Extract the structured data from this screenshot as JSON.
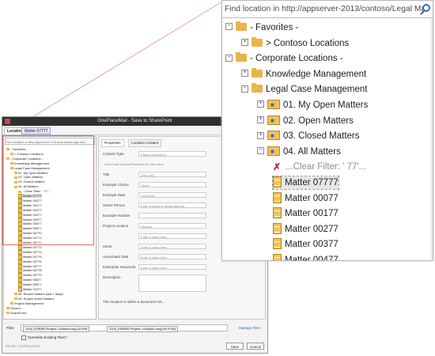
{
  "dialog": {
    "title": "OnePlaceMail - Save to SharePoint",
    "tabs": [
      "Location",
      "Matter 07777"
    ],
    "search_text": "Find location in http://appserver-2013/contoso/Legal Mat",
    "tree": [
      {
        "label": "- Favorites -",
        "level": 0
      },
      {
        "label": "> Contoso Locations",
        "level": 1
      },
      {
        "label": "- Corporate Locations -",
        "level": 0
      },
      {
        "label": "Knowledge Management",
        "level": 1
      },
      {
        "label": "Legal Case Management",
        "level": 1
      },
      {
        "label": "01. My Open Matters",
        "level": 2
      },
      {
        "label": "02. Open Matters",
        "level": 2
      },
      {
        "label": "03. Closed Matters",
        "level": 2
      },
      {
        "label": "04. All Matters",
        "level": 2
      },
      {
        "label": "...Clear Filter: ' 77'...",
        "level": 3
      },
      {
        "label": "Matter 07777",
        "level": 3
      },
      {
        "label": "Matter 00077",
        "level": 3
      },
      {
        "label": "Matter 00177",
        "level": 3
      },
      {
        "label": "Matter 00277",
        "level": 3
      },
      {
        "label": "Matter 00377",
        "level": 3
      },
      {
        "label": "Matter 00477",
        "level": 3
      },
      {
        "label": "Matter 00577",
        "level": 3
      },
      {
        "label": "Matter 00677",
        "level": 3
      },
      {
        "label": "Matter 00770",
        "level": 3
      },
      {
        "label": "Matter 00771",
        "level": 3
      },
      {
        "label": "Matter 00772",
        "level": 3
      },
      {
        "label": "Matter 00773",
        "level": 3
      },
      {
        "label": "Matter 00774",
        "level": 3
      },
      {
        "label": "Matter 00775",
        "level": 3
      },
      {
        "label": "Matter 00776",
        "level": 3
      },
      {
        "label": "Matter 00777",
        "level": 3
      },
      {
        "label": "Matter 00778",
        "level": 3
      },
      {
        "label": "Matter 00779",
        "level": 3
      },
      {
        "label": "Matter 00877",
        "level": 3
      },
      {
        "label": "Matter 00977",
        "level": 3
      },
      {
        "label": "Matter 01077",
        "level": 3
      },
      {
        "label": "05. Recent Matters (last 7 days)",
        "level": 2
      },
      {
        "label": "06. Search Active Matters",
        "level": 2
      },
      {
        "label": "Project Management",
        "level": 1
      },
      {
        "label": "Recent -",
        "level": 0
      },
      {
        "label": "SharePoint -",
        "level": 0
      }
    ],
    "props_tabs": [
      "Properties",
      "Location Content"
    ],
    "fields": [
      {
        "label": "Content Type",
        "value": "Project Document"
      },
      {
        "label": "",
        "value": "Use Email Subject/Filename as Title value"
      },
      {
        "label": "Title",
        "value": "[Sub Del]"
      },
      {
        "label": "Example Choice",
        "value": "Green"
      },
      {
        "label": "Example Date",
        "value": "1/06/2016"
      },
      {
        "label": "Select Person",
        "value": "Enter a name or email address..."
      },
      {
        "label": "Example Number",
        "value": ""
      },
      {
        "label": "Project Location",
        "value": "Nevada"
      },
      {
        "label": "",
        "value": "Enter a value here..."
      },
      {
        "label": "Client",
        "value": "Enter a value here..."
      },
      {
        "label": "Associated Task",
        "value": "Enter a value here..."
      },
      {
        "label": "Enterprise Keywords",
        "value": "Enter a value here..."
      },
      {
        "label": "Description",
        "value": ""
      }
    ],
    "note": "This location is within a document set...",
    "files_label": "Files",
    "files": [
      "1316_EDRMS Project: 1r2a8ra.msg (10 KB)",
      "1316_EDRMS Project: 1r2a8ra2.msg (60.9 KB)"
    ],
    "manage_files": "Manage Files",
    "overwrite_label": "Overwrite Existing Files?",
    "footer_link": "Simple OnePlaceMail",
    "save_label": "Save",
    "cancel_label": "Cancel"
  },
  "zoom": {
    "search_text": "Find location in http://appserver-2013/contoso/Legal Mat",
    "rows": [
      {
        "label": "- Favorites -",
        "level": 0,
        "exp": "−",
        "icon": "star-folder"
      },
      {
        "label": "> Contoso Locations",
        "level": 1,
        "exp": "+",
        "icon": "folder"
      },
      {
        "label": "- Corporate Locations -",
        "level": 0,
        "exp": "−",
        "icon": "folder"
      },
      {
        "label": "Knowledge Management",
        "level": 1,
        "exp": "+",
        "icon": "folder"
      },
      {
        "label": "Legal Case Management",
        "level": 1,
        "exp": "−",
        "icon": "folder"
      },
      {
        "label": "01. My Open Matters",
        "level": 2,
        "exp": "+",
        "icon": "search-folder"
      },
      {
        "label": "02. Open Matters",
        "level": 2,
        "exp": "+",
        "icon": "search-folder"
      },
      {
        "label": "03. Closed Matters",
        "level": 2,
        "exp": "+",
        "icon": "search-folder"
      },
      {
        "label": "04. All Matters",
        "level": 2,
        "exp": "−",
        "icon": "search-folder"
      },
      {
        "label": "...Clear Filter: ' 77'...",
        "level": 3,
        "exp": "",
        "icon": "clear-filter"
      },
      {
        "label": "Matter 07777",
        "level": 3,
        "exp": "",
        "icon": "document-set",
        "selected": true
      },
      {
        "label": "Matter 00077",
        "level": 3,
        "exp": "",
        "icon": "document-set"
      },
      {
        "label": "Matter 00177",
        "level": 3,
        "exp": "",
        "icon": "document-set"
      },
      {
        "label": "Matter 00277",
        "level": 3,
        "exp": "",
        "icon": "document-set"
      },
      {
        "label": "Matter 00377",
        "level": 3,
        "exp": "",
        "icon": "document-set"
      },
      {
        "label": "Matter 00477",
        "level": 3,
        "exp": "",
        "icon": "document-set"
      },
      {
        "label": "Matter 00577",
        "level": 3,
        "exp": "",
        "icon": "document-set"
      },
      {
        "label": "Matter 00677",
        "level": 3,
        "exp": "",
        "icon": "document-set"
      },
      {
        "label": "Matter 00770",
        "level": 3,
        "exp": "",
        "icon": "document-set"
      },
      {
        "label": "Matter 00771",
        "level": 3,
        "exp": "",
        "icon": "document-set"
      }
    ]
  },
  "colors": {
    "highlight_border": "#e06a6a",
    "accent": "#3a66c4",
    "folder": "#e9b54a"
  }
}
